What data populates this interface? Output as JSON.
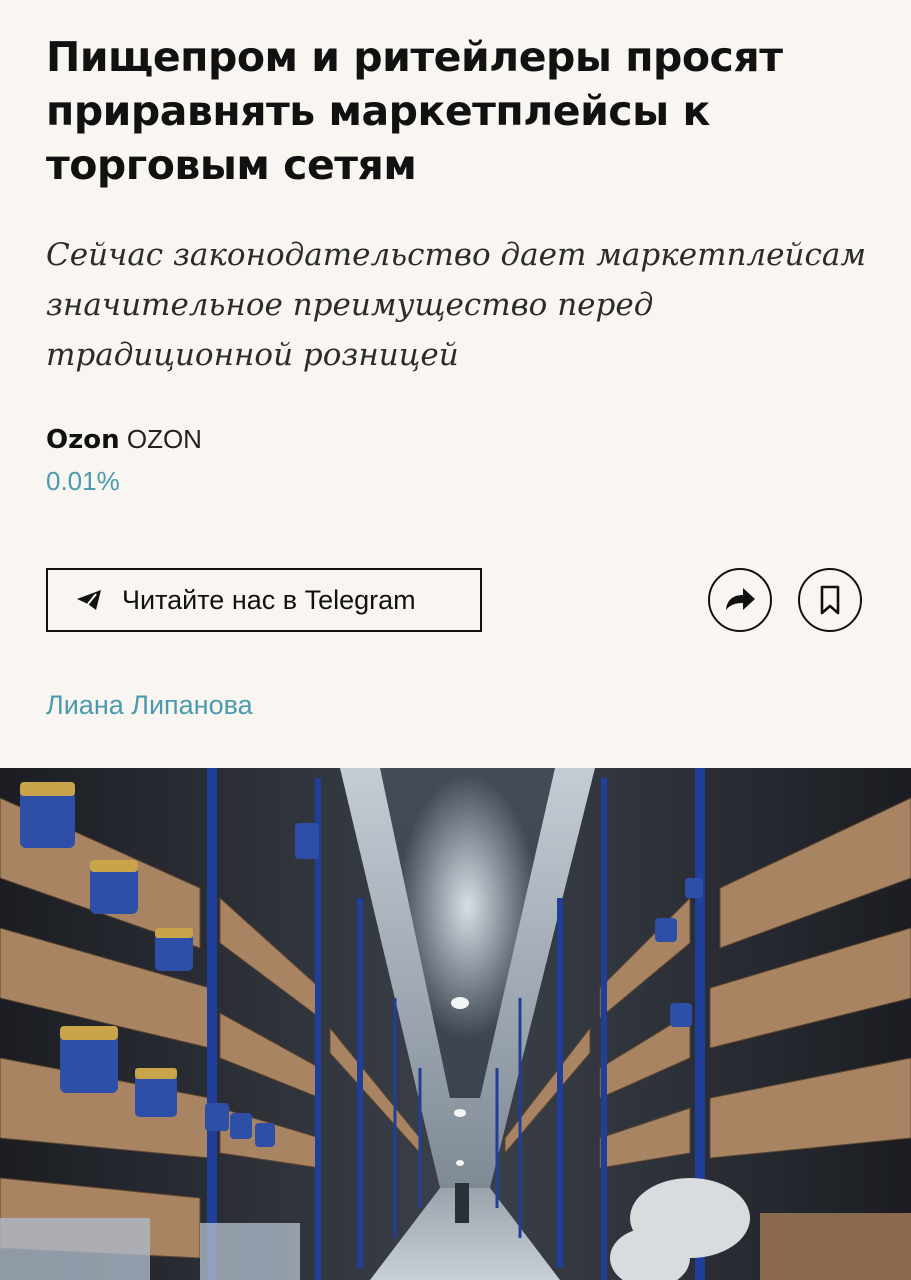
{
  "article": {
    "headline": "Пищепром и ритейлеры просят приравнять маркетплейсы к торговым сетям",
    "subtitle": "Сейчас законодательство дает маркетплейсам значительное преимущество перед традиционной розницей",
    "ticker": {
      "name": "Ozon",
      "code": "OZON",
      "change": "0.01%"
    },
    "telegram_button": {
      "label": "Читайте нас в Telegram",
      "icon": "telegram-icon"
    },
    "share_button": {
      "icon": "share-arrow-icon"
    },
    "bookmark_button": {
      "icon": "bookmark-icon"
    },
    "author": "Лиана Липанова"
  },
  "colors": {
    "background": "#f9f6f1",
    "text": "#111111",
    "accent": "#4a9ab0",
    "shelf_blue": "#1f3f9a",
    "box_tan": "#a88462"
  }
}
